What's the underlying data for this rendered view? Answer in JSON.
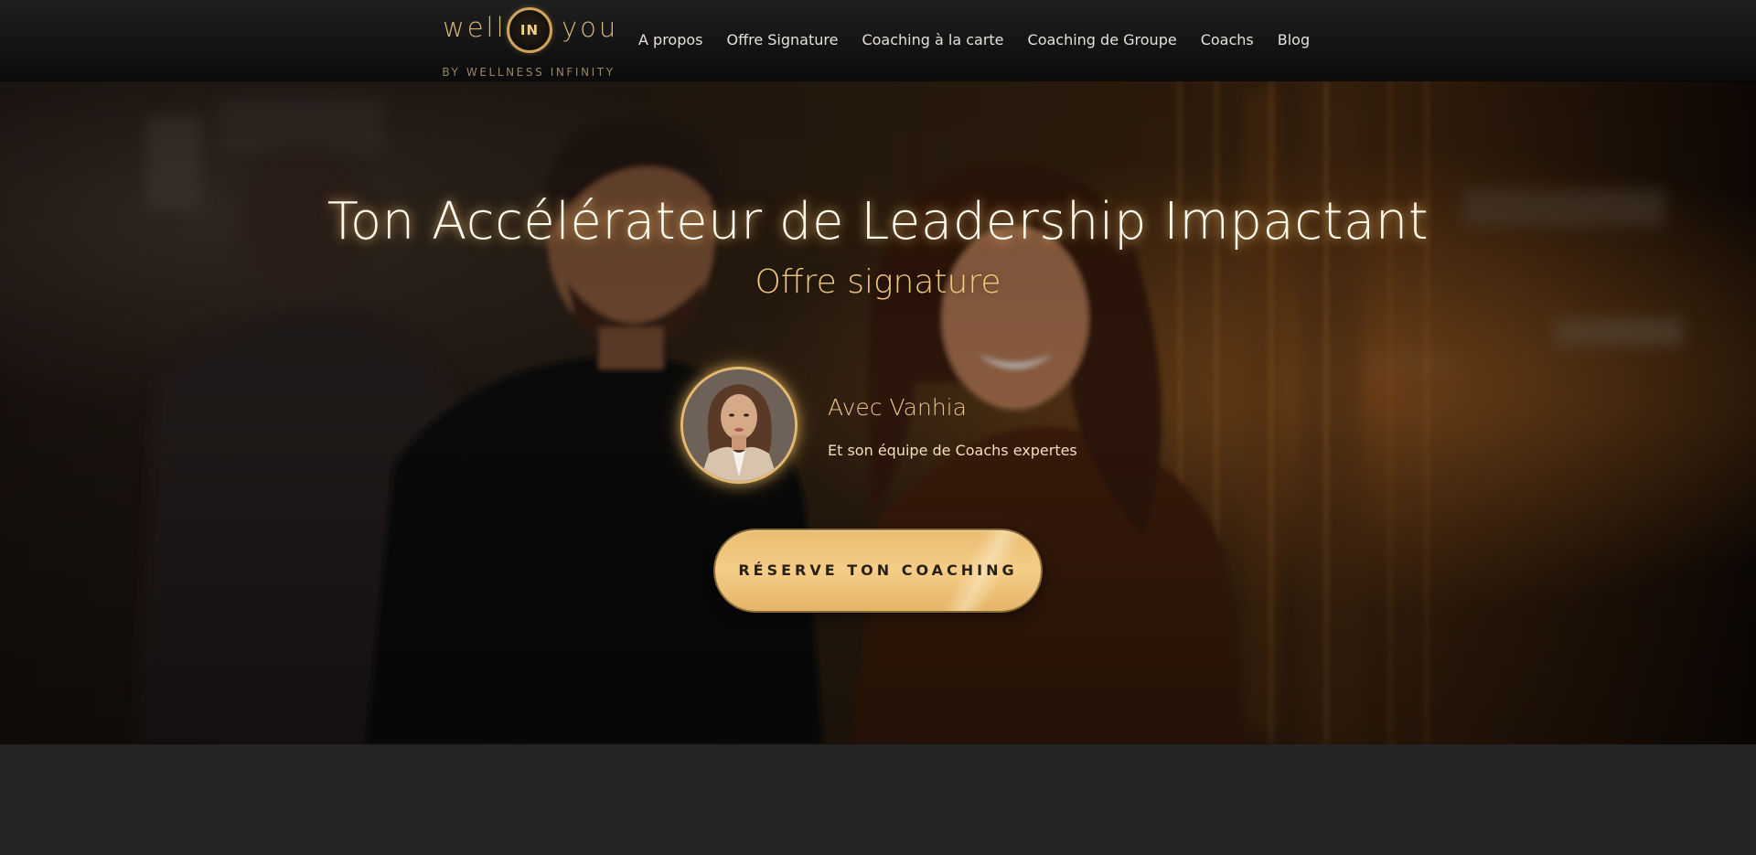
{
  "header": {
    "logo": {
      "word_left": "well",
      "word_center": "IN",
      "word_right": "you",
      "tagline": "BY WELLNESS INFINITY"
    },
    "nav": [
      {
        "label": "A propos"
      },
      {
        "label": "Offre Signature"
      },
      {
        "label": "Coaching à la carte"
      },
      {
        "label": "Coaching de Groupe"
      },
      {
        "label": "Coachs"
      },
      {
        "label": "Blog"
      }
    ]
  },
  "hero": {
    "title": "Ton Accélérateur de Leadership Impactant",
    "subtitle": "Offre signature",
    "coach_name": "Avec Vanhia",
    "coach_team": "Et son équipe de Coachs expertes",
    "cta_label": "RÉSERVE TON COACHING"
  },
  "colors": {
    "accent_gold": "#f2c97a",
    "header_bg": "#141414",
    "page_bg": "#242424"
  }
}
